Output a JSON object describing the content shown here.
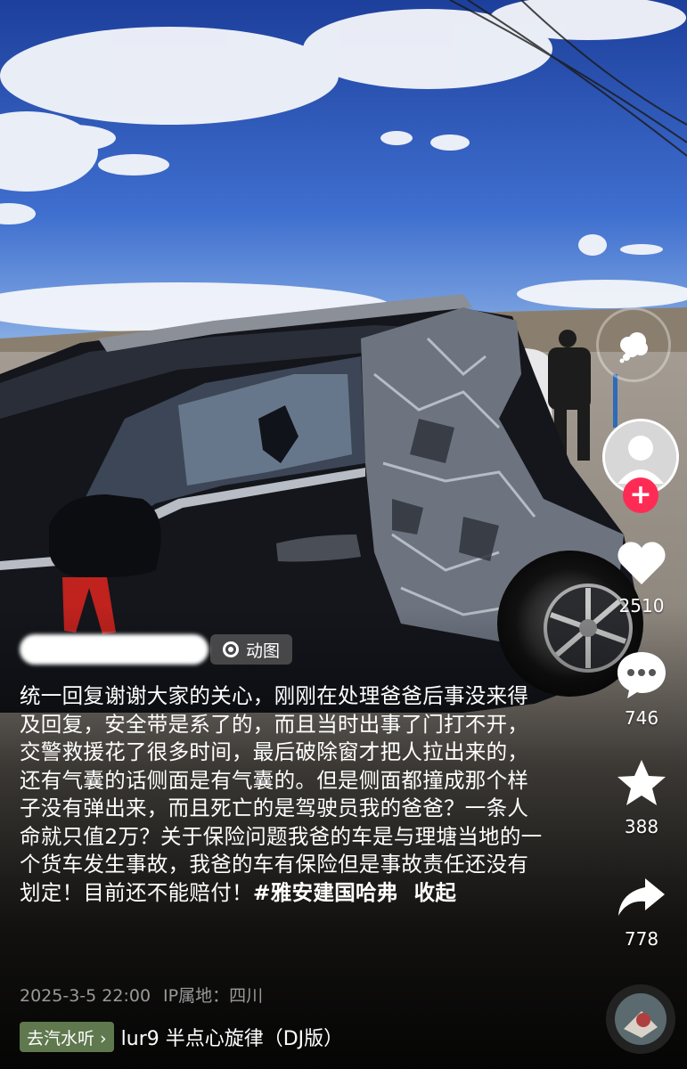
{
  "post": {
    "author_name_hidden": "",
    "media_tag": "动图",
    "description": "统一回复谢谢大家的关心，刚刚在处理爸爸后事没来得及回复，安全带是系了的，而且当时出事了门打不开，交警救援花了很多时间，最后破除窗才把人拉出来的，还有气囊的话侧面是有气囊的。但是侧面都撞成那个样子没有弹出来，而且死亡的是驾驶员我的爸爸？一条人命就只值2万？关于保险问题我爸的车是与理塘当地的一个货车发生事故，我爸的车有保险但是事故责任还没有划定！目前还不能赔付！",
    "hashtag": "#雅安建国哈弗",
    "fold_label": "收起",
    "date": "2025-3-5 22:00",
    "ip_location": "IP属地：四川"
  },
  "actions": {
    "likes": "2510",
    "comments": "746",
    "favorites": "388",
    "shares": "778"
  },
  "music": {
    "chip_label": "去汽水听 ›",
    "title": "lur9    半点心旋律（DJ版）"
  },
  "icons": {
    "effect": "cloud-effect-icon",
    "follow": "plus-icon",
    "like": "heart-icon",
    "comment": "comment-bubble-icon",
    "favorite": "star-icon",
    "share": "share-arrow-icon",
    "media": "gif-ring-icon"
  },
  "colors": {
    "follow": "#fe2c55",
    "chip": "#6e8c5a"
  }
}
